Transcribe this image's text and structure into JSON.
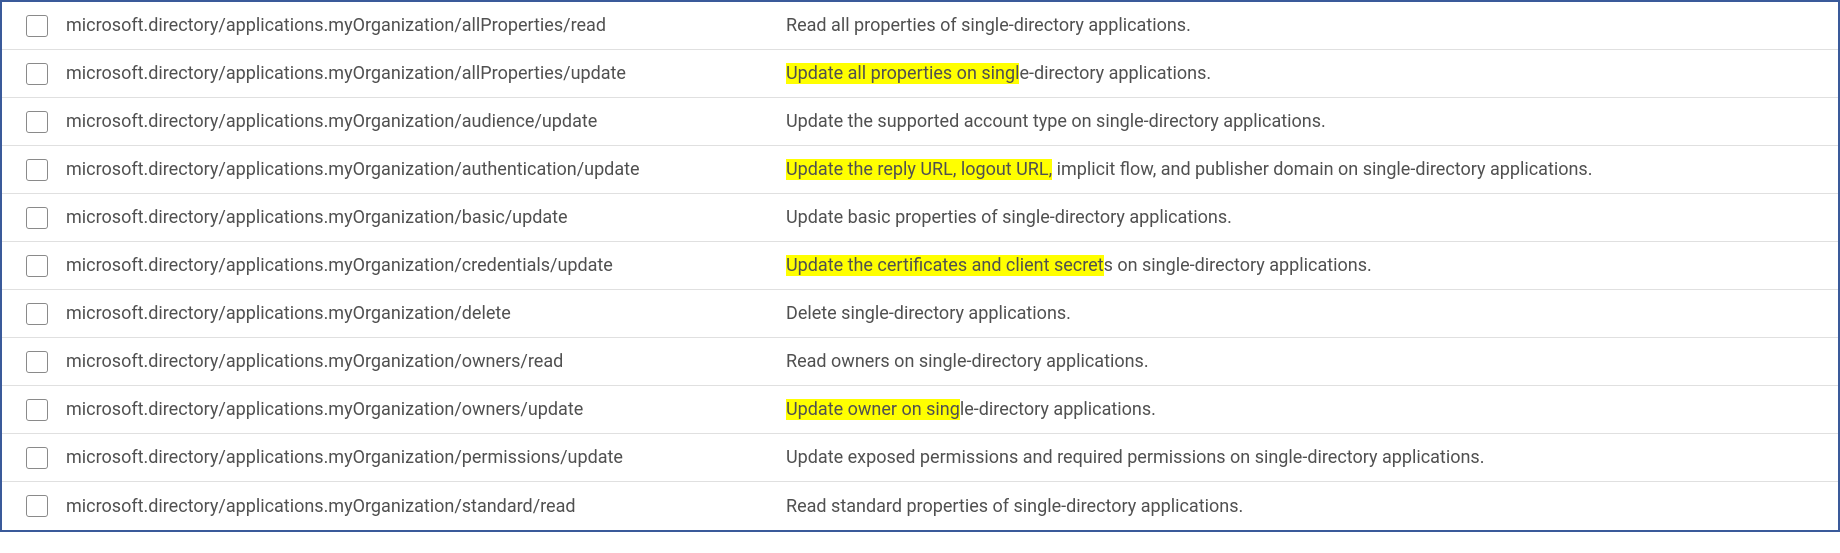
{
  "rows": [
    {
      "permission": "microsoft.directory/applications.myOrganization/allProperties/read",
      "description": "Read all properties of single-directory applications.",
      "highlight": null
    },
    {
      "permission": "microsoft.directory/applications.myOrganization/allProperties/update",
      "description": "Update all properties on single-directory applications.",
      "highlight": "Update all properties on singl"
    },
    {
      "permission": "microsoft.directory/applications.myOrganization/audience/update",
      "description": "Update the supported account type on single-directory applications.",
      "highlight": null
    },
    {
      "permission": "microsoft.directory/applications.myOrganization/authentication/update",
      "description": "Update the reply URL, logout URL, implicit flow, and publisher domain on single-directory applications.",
      "highlight": "Update the reply URL, logout URL,"
    },
    {
      "permission": "microsoft.directory/applications.myOrganization/basic/update",
      "description": "Update basic properties of single-directory applications.",
      "highlight": null
    },
    {
      "permission": "microsoft.directory/applications.myOrganization/credentials/update",
      "description": "Update the certificates and client secrets on single-directory applications.",
      "highlight": "Update the certificates and client secret"
    },
    {
      "permission": "microsoft.directory/applications.myOrganization/delete",
      "description": "Delete single-directory applications.",
      "highlight": null
    },
    {
      "permission": "microsoft.directory/applications.myOrganization/owners/read",
      "description": "Read owners on single-directory applications.",
      "highlight": null
    },
    {
      "permission": "microsoft.directory/applications.myOrganization/owners/update",
      "description": "Update owner on single-directory applications.",
      "highlight": "Update owner on sing"
    },
    {
      "permission": "microsoft.directory/applications.myOrganization/permissions/update",
      "description": "Update exposed permissions and required permissions on single-directory applications.",
      "highlight": null
    },
    {
      "permission": "microsoft.directory/applications.myOrganization/standard/read",
      "description": "Read standard properties of single-directory applications.",
      "highlight": null
    }
  ]
}
